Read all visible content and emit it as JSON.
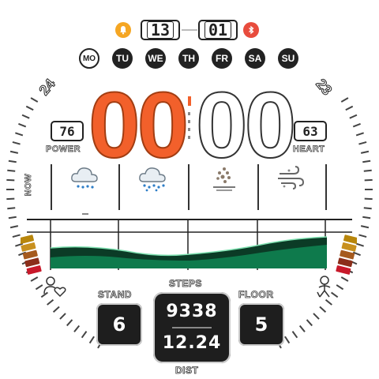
{
  "top": {
    "date": "13",
    "month": "01",
    "alarm_color": "#f5a623",
    "bluetooth_color": "#e84c3d"
  },
  "weekdays": [
    {
      "label": "MO",
      "active": true
    },
    {
      "label": "TU",
      "active": false
    },
    {
      "label": "WE",
      "active": false
    },
    {
      "label": "TH",
      "active": false
    },
    {
      "label": "FR",
      "active": false
    },
    {
      "label": "SA",
      "active": false
    },
    {
      "label": "SU",
      "active": false
    }
  ],
  "time": {
    "hours": "00",
    "minutes": "00",
    "hours_color": "#f2602b"
  },
  "power": {
    "value": "76",
    "label": "POWER"
  },
  "heart": {
    "value": "63",
    "label": "HEART"
  },
  "left_number": "24",
  "right_number": "23",
  "weather": {
    "now_label": "NOW",
    "icons": [
      "rain-cloud-icon",
      "heavy-rain-cloud-icon",
      "dust-icon",
      "windy-icon"
    ]
  },
  "stand": {
    "label": "STAND",
    "value": "6"
  },
  "steps": {
    "label": "STEPS",
    "value": "9338"
  },
  "distance": {
    "label": "DIST",
    "value": "12.24"
  },
  "floor": {
    "label": "FLOOR",
    "value": "5"
  },
  "colors": {
    "graph_green": "#0e7a4c",
    "graph_dark": "#0b3b26"
  }
}
